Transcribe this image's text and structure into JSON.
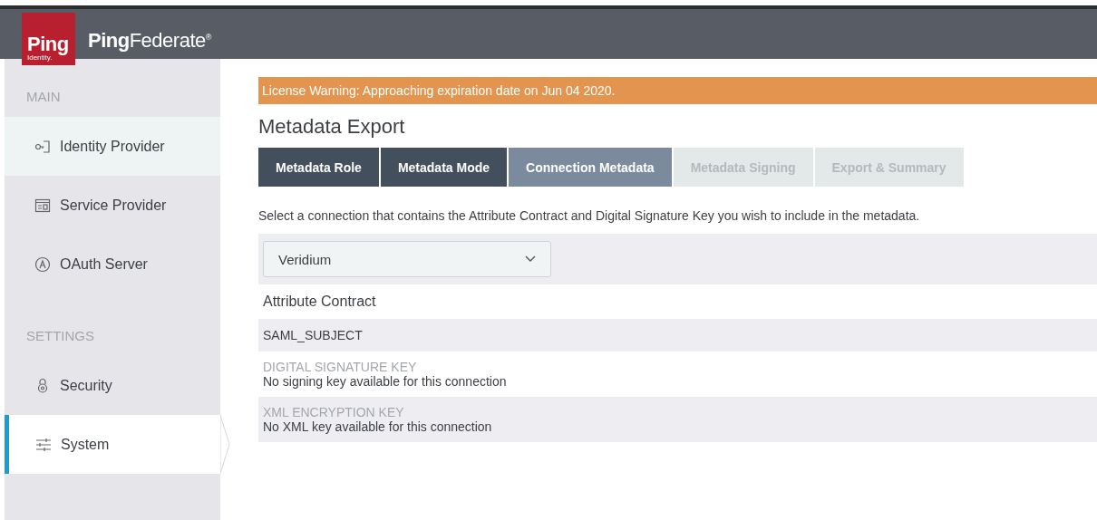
{
  "header": {
    "logo": {
      "word": "Ping",
      "sub": "Identity."
    },
    "product": {
      "bold": "Ping",
      "light": "Federate",
      "mark": "®"
    }
  },
  "sidebar": {
    "sections": [
      {
        "title": "MAIN",
        "items": [
          {
            "label": "Identity Provider",
            "highlighted": true,
            "selected": false
          },
          {
            "label": "Service Provider",
            "highlighted": false,
            "selected": false
          },
          {
            "label": "OAuth Server",
            "highlighted": false,
            "selected": false
          }
        ]
      },
      {
        "title": "SETTINGS",
        "items": [
          {
            "label": "Security",
            "highlighted": false,
            "selected": false
          },
          {
            "label": "System",
            "highlighted": false,
            "selected": true
          }
        ]
      }
    ]
  },
  "warning": "License Warning: Approaching expiration date on Jun 04 2020.",
  "page_title": "Metadata Export",
  "steps": [
    {
      "label": "Metadata Role",
      "completed": true,
      "selected": false
    },
    {
      "label": "Metadata Mode",
      "completed": true,
      "selected": false
    },
    {
      "label": "Connection Metadata",
      "completed": false,
      "selected": true
    },
    {
      "label": "Metadata Signing",
      "completed": false,
      "selected": false
    },
    {
      "label": "Export & Summary",
      "completed": false,
      "selected": false
    }
  ],
  "instruction": "Select a connection that contains the Attribute Contract and Digital Signature Key you wish to include in the metadata.",
  "connection_select": {
    "value": "Veridium"
  },
  "attribute_contract": {
    "heading": "Attribute Contract",
    "attributes": [
      "SAML_SUBJECT"
    ]
  },
  "keys": [
    {
      "label": "DIGITAL SIGNATURE KEY",
      "value": "No signing key available for this connection"
    },
    {
      "label": "XML ENCRYPTION KEY",
      "value": "No XML key available for this connection"
    }
  ]
}
